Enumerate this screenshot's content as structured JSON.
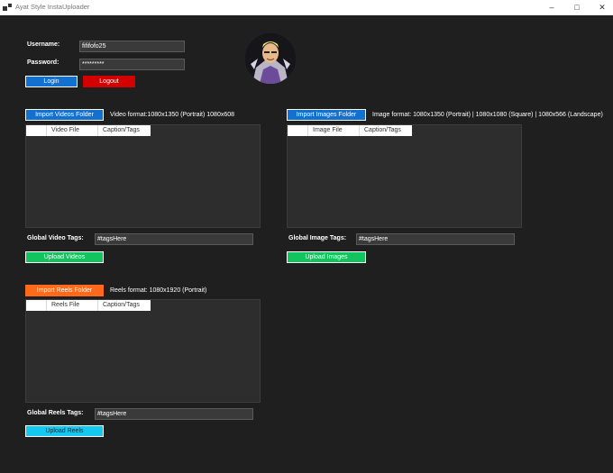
{
  "window": {
    "title": "Ayat Style InstaUploader"
  },
  "colors": {
    "blue": "#1170d0",
    "red": "#d40000",
    "green": "#12c45e",
    "orange": "#ff6a1a",
    "cyan": "#14c8f0"
  },
  "login": {
    "username_label": "Username:",
    "username_value": "fififofo25",
    "password_label": "Password:",
    "password_value": "*********",
    "login_button": "Login",
    "logout_button": "Logout"
  },
  "videos": {
    "import_button": "Import Videos Folder",
    "format_text": "Video format:1080x1350 (Portrait) 1080x608",
    "col_file": "Video File",
    "col_caption": "Caption/Tags",
    "tags_label": "Global Video Tags:",
    "tags_value": "#tagsHere",
    "upload_button": "Upload Videos"
  },
  "images": {
    "import_button": "Import Images Folder",
    "format_text": "Image format: 1080x1350 (Portrait) | 1080x1080 (Square) | 1080x566 (Landscape)",
    "col_file": "Image File",
    "col_caption": "Caption/Tags",
    "tags_label": "Global Image Tags:",
    "tags_value": "#tagsHere",
    "upload_button": "Upload Images"
  },
  "reels": {
    "import_button": "Import Reels Folder",
    "format_text": "Reels format: 1080x1920 (Portrait)",
    "col_file": "Reels File",
    "col_caption": "Caption/Tags",
    "tags_label": "Global Reels Tags:",
    "tags_value": "#tagsHere",
    "upload_button": "Upload Reels"
  }
}
